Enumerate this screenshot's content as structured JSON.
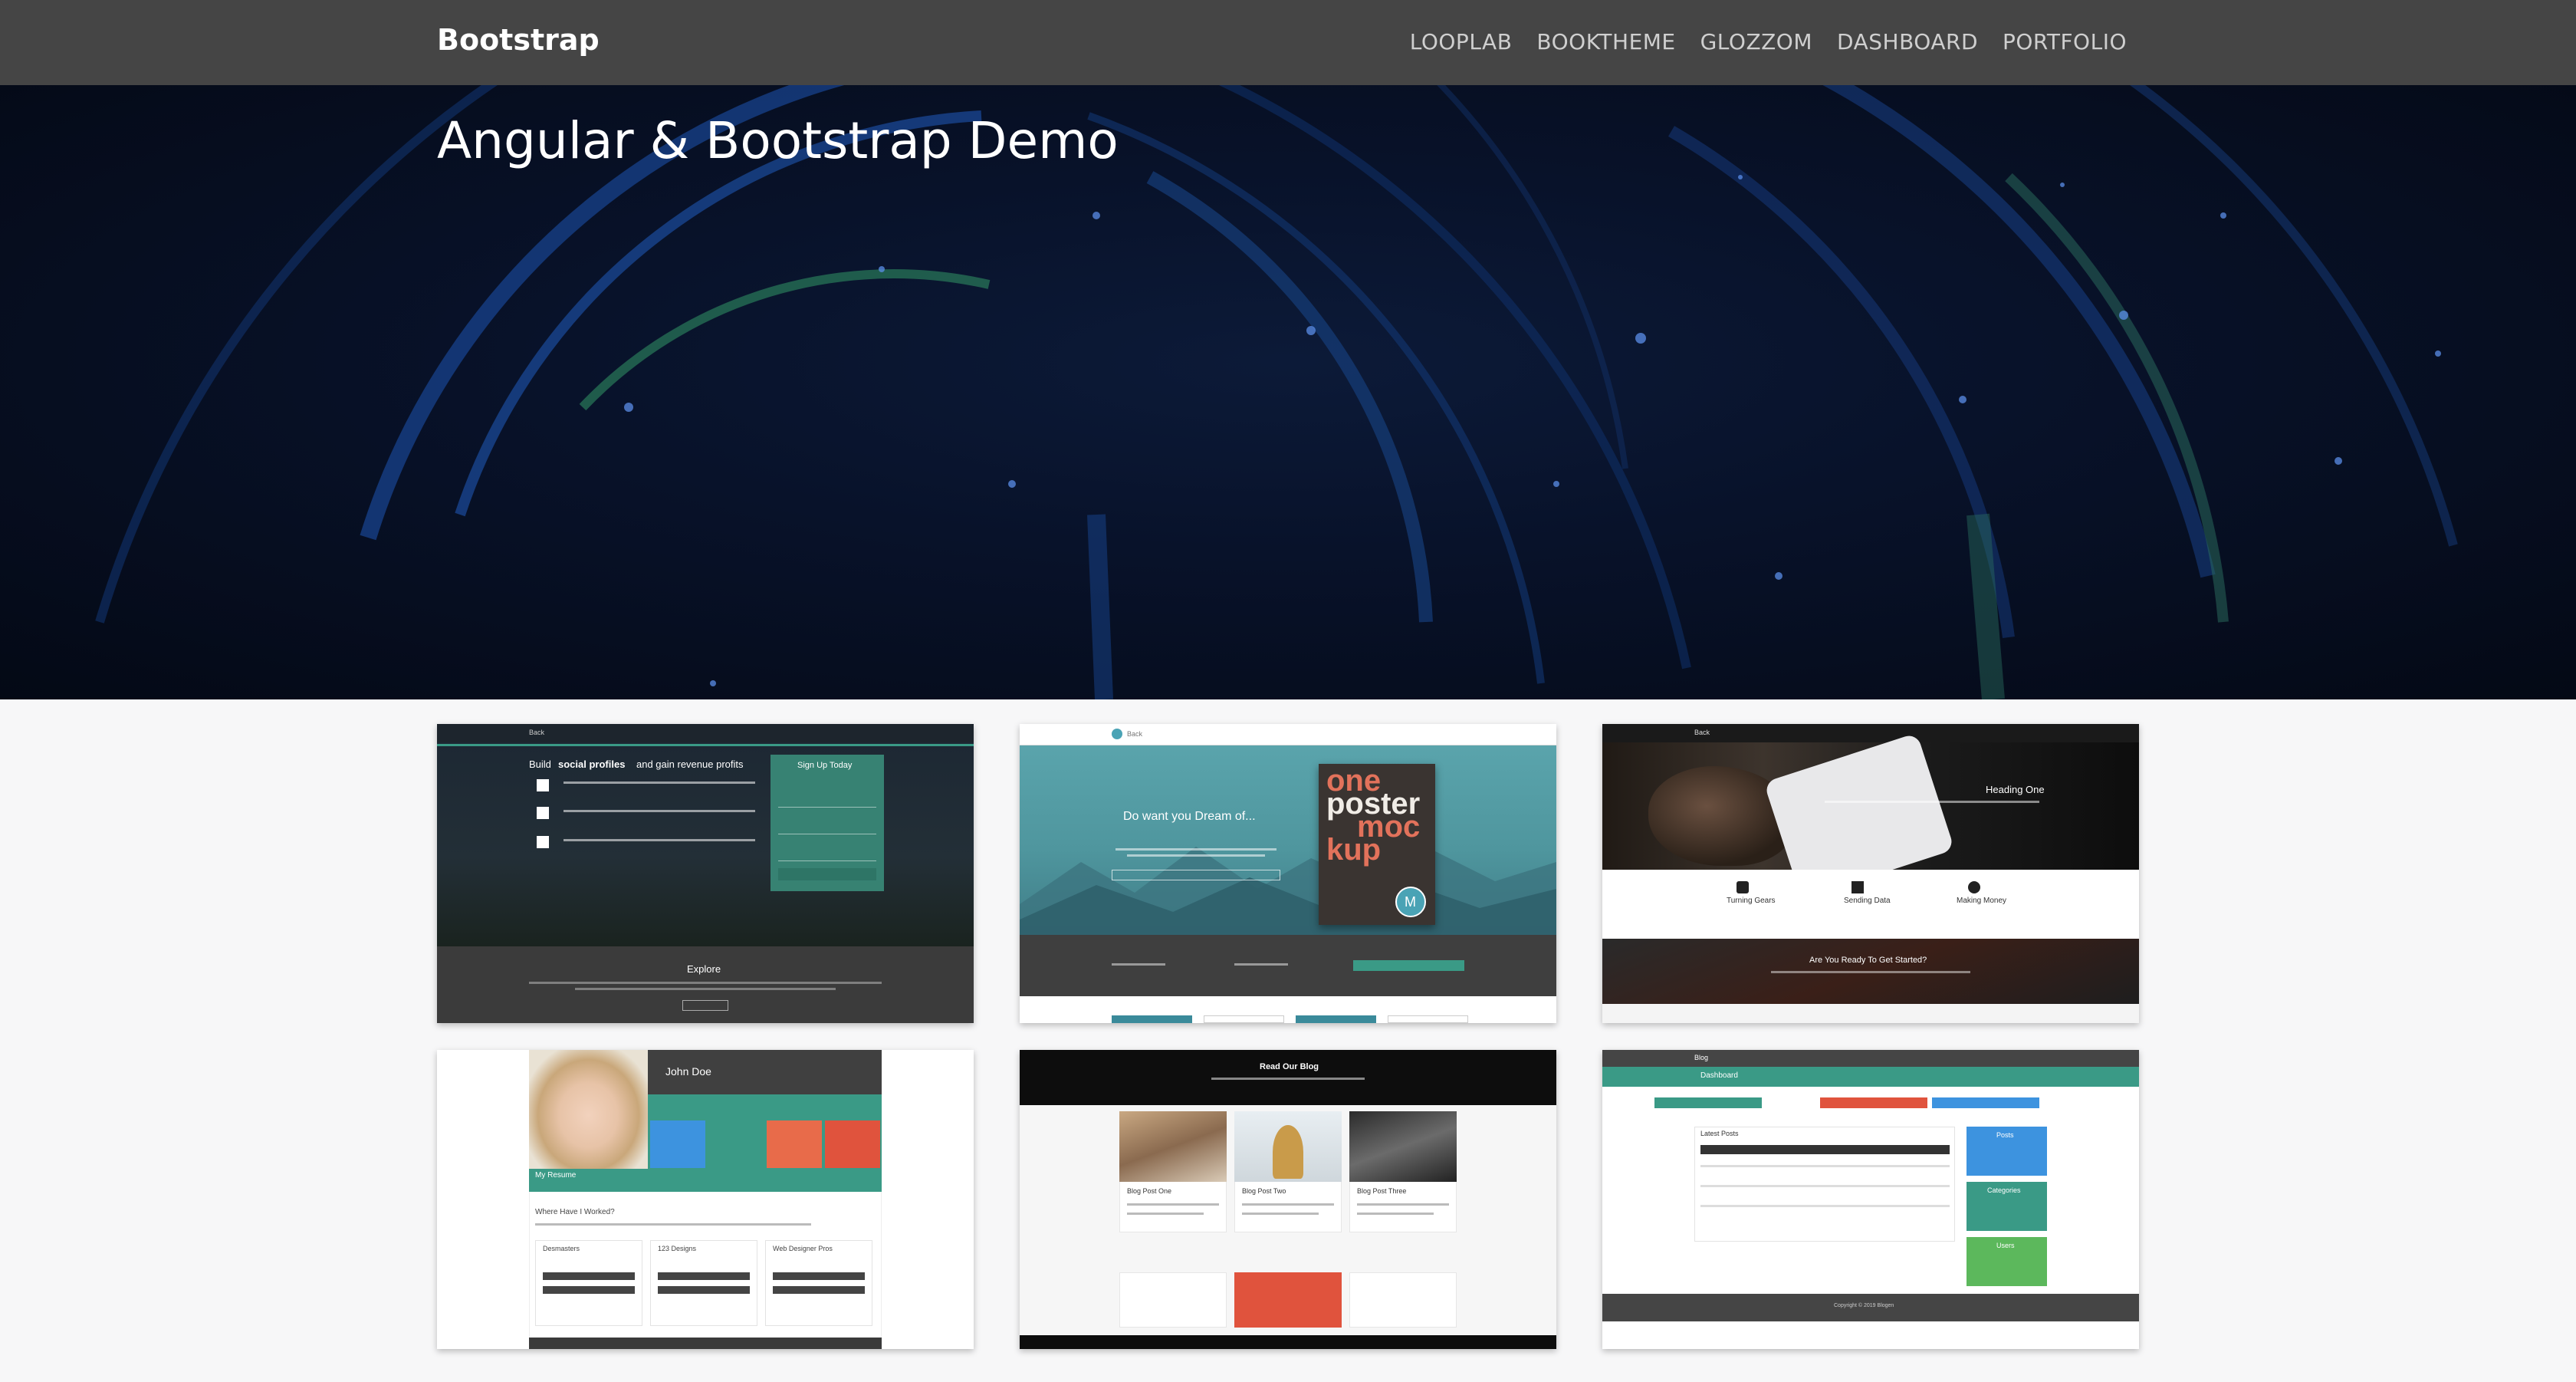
{
  "navbar": {
    "brand": "Bootstrap",
    "links": [
      "LOOPLAB",
      "BOOKTHEME",
      "GLOZZOM",
      "DASHBOARD",
      "PORTFOLIO"
    ]
  },
  "hero": {
    "title": "Angular & Bootstrap Demo"
  },
  "thumbnails": {
    "t1": {
      "brand": "Back",
      "headline_pre": "Build",
      "headline_bold": "social profiles",
      "headline_post": "and gain revenue profits",
      "form_title": "Sign Up Today",
      "section_title": "Explore"
    },
    "t2": {
      "brand": "Back",
      "headline": "Do want you Dream of...",
      "poster_words": [
        "one",
        "poster",
        "moc",
        "kup"
      ],
      "poster_badge": "M"
    },
    "t3": {
      "brand": "Back",
      "slide_heading": "Heading One",
      "features": [
        "Turning Gears",
        "Sending Data",
        "Making Money"
      ],
      "cta": "Are You Ready To Get Started?"
    },
    "t4": {
      "name": "John Doe",
      "section": "My Resume",
      "subtitle": "Where Have I Worked?",
      "jobs": [
        "Desmasters",
        "123 Designs",
        "Web Designer Pros"
      ]
    },
    "t5": {
      "header": "Read Our Blog",
      "posts": [
        "Blog Post One",
        "Blog Post Two",
        "Blog Post Three"
      ]
    },
    "t6": {
      "brand": "Blog",
      "title": "Dashboard",
      "table_title": "Latest Posts",
      "cards": [
        "Posts",
        "Categories",
        "Users"
      ],
      "footer": "Copyright © 2019 Blogen"
    }
  },
  "colors": {
    "navbar": "#454545",
    "teal": "#3a9a86",
    "hero_blue": "#1d4fa8",
    "hero_green": "#2f8a5a"
  }
}
